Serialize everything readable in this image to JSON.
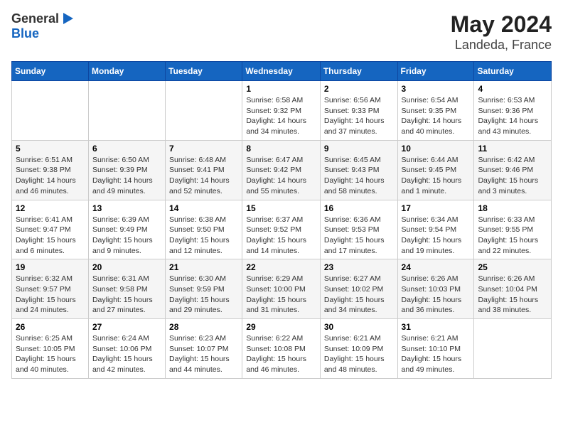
{
  "header": {
    "logo_general": "General",
    "logo_blue": "Blue",
    "title": "May 2024",
    "subtitle": "Landeda, France"
  },
  "days_of_week": [
    "Sunday",
    "Monday",
    "Tuesday",
    "Wednesday",
    "Thursday",
    "Friday",
    "Saturday"
  ],
  "weeks": [
    [
      {
        "day": "",
        "detail": ""
      },
      {
        "day": "",
        "detail": ""
      },
      {
        "day": "",
        "detail": ""
      },
      {
        "day": "1",
        "detail": "Sunrise: 6:58 AM\nSunset: 9:32 PM\nDaylight: 14 hours and 34 minutes."
      },
      {
        "day": "2",
        "detail": "Sunrise: 6:56 AM\nSunset: 9:33 PM\nDaylight: 14 hours and 37 minutes."
      },
      {
        "day": "3",
        "detail": "Sunrise: 6:54 AM\nSunset: 9:35 PM\nDaylight: 14 hours and 40 minutes."
      },
      {
        "day": "4",
        "detail": "Sunrise: 6:53 AM\nSunset: 9:36 PM\nDaylight: 14 hours and 43 minutes."
      }
    ],
    [
      {
        "day": "5",
        "detail": "Sunrise: 6:51 AM\nSunset: 9:38 PM\nDaylight: 14 hours and 46 minutes."
      },
      {
        "day": "6",
        "detail": "Sunrise: 6:50 AM\nSunset: 9:39 PM\nDaylight: 14 hours and 49 minutes."
      },
      {
        "day": "7",
        "detail": "Sunrise: 6:48 AM\nSunset: 9:41 PM\nDaylight: 14 hours and 52 minutes."
      },
      {
        "day": "8",
        "detail": "Sunrise: 6:47 AM\nSunset: 9:42 PM\nDaylight: 14 hours and 55 minutes."
      },
      {
        "day": "9",
        "detail": "Sunrise: 6:45 AM\nSunset: 9:43 PM\nDaylight: 14 hours and 58 minutes."
      },
      {
        "day": "10",
        "detail": "Sunrise: 6:44 AM\nSunset: 9:45 PM\nDaylight: 15 hours and 1 minute."
      },
      {
        "day": "11",
        "detail": "Sunrise: 6:42 AM\nSunset: 9:46 PM\nDaylight: 15 hours and 3 minutes."
      }
    ],
    [
      {
        "day": "12",
        "detail": "Sunrise: 6:41 AM\nSunset: 9:47 PM\nDaylight: 15 hours and 6 minutes."
      },
      {
        "day": "13",
        "detail": "Sunrise: 6:39 AM\nSunset: 9:49 PM\nDaylight: 15 hours and 9 minutes."
      },
      {
        "day": "14",
        "detail": "Sunrise: 6:38 AM\nSunset: 9:50 PM\nDaylight: 15 hours and 12 minutes."
      },
      {
        "day": "15",
        "detail": "Sunrise: 6:37 AM\nSunset: 9:52 PM\nDaylight: 15 hours and 14 minutes."
      },
      {
        "day": "16",
        "detail": "Sunrise: 6:36 AM\nSunset: 9:53 PM\nDaylight: 15 hours and 17 minutes."
      },
      {
        "day": "17",
        "detail": "Sunrise: 6:34 AM\nSunset: 9:54 PM\nDaylight: 15 hours and 19 minutes."
      },
      {
        "day": "18",
        "detail": "Sunrise: 6:33 AM\nSunset: 9:55 PM\nDaylight: 15 hours and 22 minutes."
      }
    ],
    [
      {
        "day": "19",
        "detail": "Sunrise: 6:32 AM\nSunset: 9:57 PM\nDaylight: 15 hours and 24 minutes."
      },
      {
        "day": "20",
        "detail": "Sunrise: 6:31 AM\nSunset: 9:58 PM\nDaylight: 15 hours and 27 minutes."
      },
      {
        "day": "21",
        "detail": "Sunrise: 6:30 AM\nSunset: 9:59 PM\nDaylight: 15 hours and 29 minutes."
      },
      {
        "day": "22",
        "detail": "Sunrise: 6:29 AM\nSunset: 10:00 PM\nDaylight: 15 hours and 31 minutes."
      },
      {
        "day": "23",
        "detail": "Sunrise: 6:27 AM\nSunset: 10:02 PM\nDaylight: 15 hours and 34 minutes."
      },
      {
        "day": "24",
        "detail": "Sunrise: 6:26 AM\nSunset: 10:03 PM\nDaylight: 15 hours and 36 minutes."
      },
      {
        "day": "25",
        "detail": "Sunrise: 6:26 AM\nSunset: 10:04 PM\nDaylight: 15 hours and 38 minutes."
      }
    ],
    [
      {
        "day": "26",
        "detail": "Sunrise: 6:25 AM\nSunset: 10:05 PM\nDaylight: 15 hours and 40 minutes."
      },
      {
        "day": "27",
        "detail": "Sunrise: 6:24 AM\nSunset: 10:06 PM\nDaylight: 15 hours and 42 minutes."
      },
      {
        "day": "28",
        "detail": "Sunrise: 6:23 AM\nSunset: 10:07 PM\nDaylight: 15 hours and 44 minutes."
      },
      {
        "day": "29",
        "detail": "Sunrise: 6:22 AM\nSunset: 10:08 PM\nDaylight: 15 hours and 46 minutes."
      },
      {
        "day": "30",
        "detail": "Sunrise: 6:21 AM\nSunset: 10:09 PM\nDaylight: 15 hours and 48 minutes."
      },
      {
        "day": "31",
        "detail": "Sunrise: 6:21 AM\nSunset: 10:10 PM\nDaylight: 15 hours and 49 minutes."
      },
      {
        "day": "",
        "detail": ""
      }
    ]
  ]
}
